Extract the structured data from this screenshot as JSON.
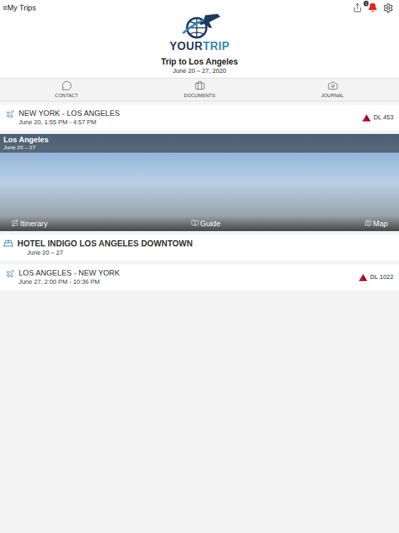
{
  "topbar": {
    "menu_icon": "≡",
    "menu_label": "My Trips",
    "notification_badge": "1"
  },
  "logo": {
    "first": "YOUR",
    "second": "TRIP"
  },
  "trip": {
    "title": "Trip to Los Angeles",
    "dates": "June 20 – 27, 2020"
  },
  "tabs": [
    {
      "label": "CONTACT",
      "selected": false
    },
    {
      "label": "DOCUMENTS",
      "selected": false
    },
    {
      "label": "JOURNAL",
      "selected": false
    }
  ],
  "items": [
    {
      "kind": "flight",
      "title": "NEW YORK - LOS ANGELES",
      "subtitle": "June 20, 1:55 PM - 4:57 PM",
      "flight_number": "DL 453"
    },
    {
      "kind": "destination",
      "title": "Los Angeles",
      "subtitle": "June 20 – 27",
      "links": [
        "Itinerary",
        "Guide",
        "Map"
      ]
    },
    {
      "kind": "hotel",
      "title": "HOTEL INDIGO LOS ANGELES DOWNTOWN",
      "subtitle": "June 20 – 27"
    },
    {
      "kind": "flight",
      "title": "LOS ANGELES - NEW YORK",
      "subtitle": "June 27, 2:00 PM - 10:36 PM",
      "flight_number": "DL 1022"
    }
  ]
}
